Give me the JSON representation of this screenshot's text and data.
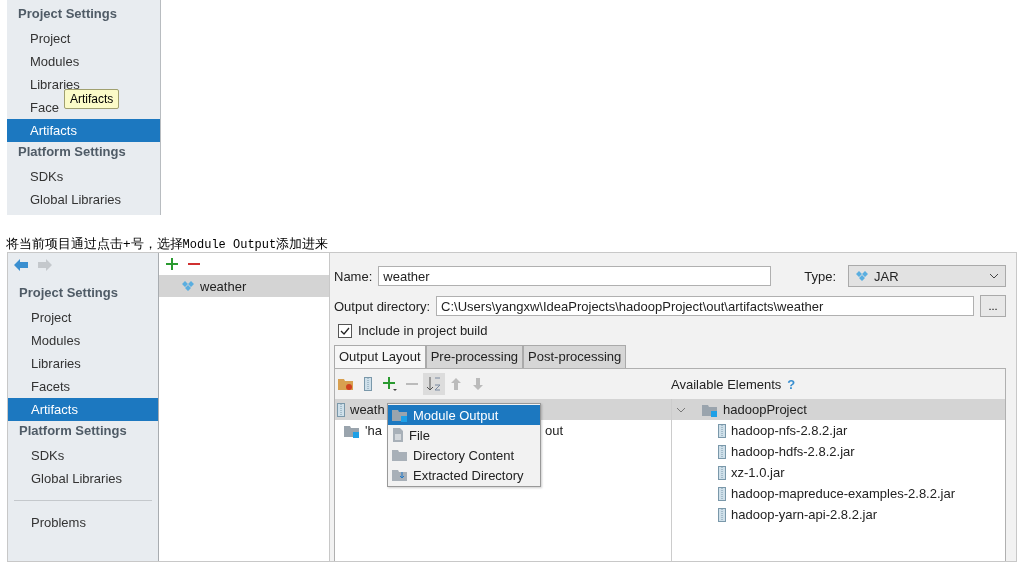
{
  "top_panel": {
    "groups": [
      {
        "title": "Project Settings",
        "items": [
          {
            "label": "Project",
            "selected": false
          },
          {
            "label": "Modules",
            "selected": false
          },
          {
            "label": "Libraries",
            "selected": false
          },
          {
            "label": "Face",
            "selected": false
          },
          {
            "label": "Artifacts",
            "selected": true
          }
        ]
      },
      {
        "title": "Platform Settings",
        "items": [
          {
            "label": "SDKs",
            "selected": false
          },
          {
            "label": "Global Libraries",
            "selected": false
          }
        ]
      }
    ],
    "tooltip": "Artifacts"
  },
  "caption": [
    {
      "kind": "plain",
      "text": "将当前项目通过点击+号，选择"
    },
    {
      "kind": "mono",
      "text": "Module Output"
    },
    {
      "kind": "plain",
      "text": "添加进来"
    }
  ],
  "dialog": {
    "sidebar": {
      "groups": [
        {
          "title": "Project Settings",
          "items": [
            {
              "label": "Project",
              "selected": false
            },
            {
              "label": "Modules",
              "selected": false
            },
            {
              "label": "Libraries",
              "selected": false
            },
            {
              "label": "Facets",
              "selected": false
            },
            {
              "label": "Artifacts",
              "selected": true
            }
          ]
        },
        {
          "title": "Platform Settings",
          "items": [
            {
              "label": "SDKs",
              "selected": false
            },
            {
              "label": "Global Libraries",
              "selected": false
            }
          ]
        }
      ],
      "problems": "Problems"
    },
    "artifacts": [
      {
        "label": "weather",
        "selected": true
      }
    ],
    "name_label": "Name:",
    "name_value": "weather",
    "type_label": "Type:",
    "type_value": "JAR",
    "output_label": "Output directory:",
    "output_value": "C:\\Users\\yangxw\\IdeaProjects\\hadoopProject\\out\\artifacts\\weather",
    "browse": "...",
    "include": {
      "label": "Include in project build",
      "checked": true
    },
    "tabs": [
      {
        "label": "Output Layout",
        "selected": true
      },
      {
        "label": "Pre-processing",
        "selected": false
      },
      {
        "label": "Post-processing",
        "selected": false
      }
    ],
    "layout_tree": [
      {
        "label": "weath",
        "selected": true
      },
      {
        "label_start": "'ha",
        "label_end": "out",
        "selected": false
      }
    ],
    "menu": [
      {
        "label": "Module Output",
        "selected": true,
        "kind": "module"
      },
      {
        "label": "File",
        "selected": false,
        "kind": "file"
      },
      {
        "label": "Directory Content",
        "selected": false,
        "kind": "folder"
      },
      {
        "label": "Extracted Directory",
        "selected": false,
        "kind": "extract"
      }
    ],
    "available_title": "Available Elements",
    "help": "?",
    "available": {
      "label": "hadoopProject",
      "expanded": true,
      "selected": true,
      "children": [
        {
          "label": "hadoop-nfs-2.8.2.jar",
          "selected": false
        },
        {
          "label": "hadoop-hdfs-2.8.2.jar",
          "selected": false
        },
        {
          "label": "xz-1.0.jar",
          "selected": false
        },
        {
          "label": "hadoop-mapreduce-examples-2.8.2.jar",
          "selected": false
        },
        {
          "label": "hadoop-yarn-api-2.8.2.jar",
          "selected": false
        }
      ]
    }
  }
}
